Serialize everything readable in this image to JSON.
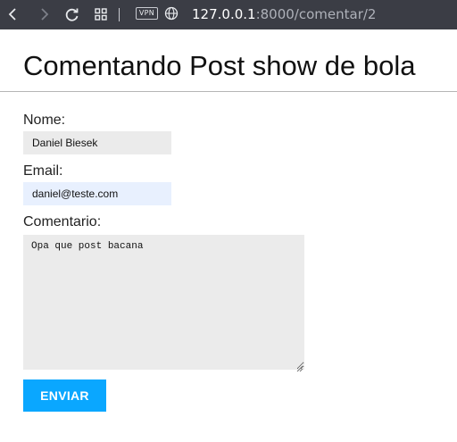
{
  "browser": {
    "vpn_label": "VPN",
    "url_host": "127.0.0.1",
    "url_path": ":8000/comentar/2",
    "icons": [
      "back-icon",
      "forward-icon",
      "reload-icon",
      "tabs-grid-icon",
      "globe-icon"
    ]
  },
  "page": {
    "title": "Comentando Post show de bola"
  },
  "form": {
    "nome_label": "Nome:",
    "nome_value": "Daniel Biesek",
    "email_label": "Email:",
    "email_value": "daniel@teste.com",
    "comentario_label": "Comentario:",
    "comentario_value": "Opa que post bacana",
    "submit_label": "ENVIAR"
  },
  "colors": {
    "browser_bar": "#3b3d45",
    "input_background": "#ebebeb",
    "autofill_background": "#e8f0fe",
    "button": "#0aa7ff"
  }
}
